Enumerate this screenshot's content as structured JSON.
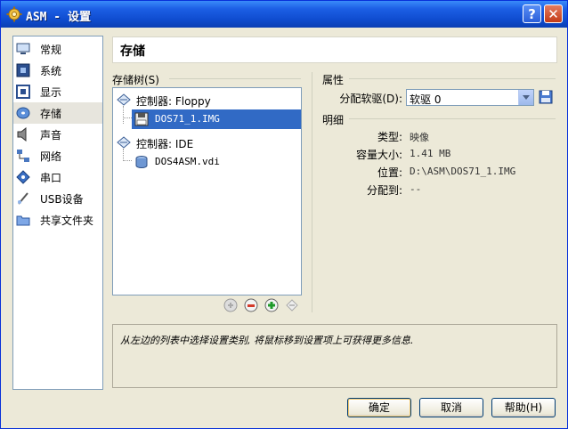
{
  "window": {
    "title": "ASM - 设置"
  },
  "sidebar": {
    "items": [
      {
        "label": "常规",
        "icon": "monitor-icon"
      },
      {
        "label": "系统",
        "icon": "chip-icon"
      },
      {
        "label": "显示",
        "icon": "display-icon"
      },
      {
        "label": "存储",
        "icon": "disk-icon",
        "selected": true
      },
      {
        "label": "声音",
        "icon": "speaker-icon"
      },
      {
        "label": "网络",
        "icon": "network-icon"
      },
      {
        "label": "串口",
        "icon": "serial-port-icon"
      },
      {
        "label": "USB设备",
        "icon": "usb-icon"
      },
      {
        "label": "共享文件夹",
        "icon": "folder-icon"
      }
    ]
  },
  "page": {
    "title": "存储"
  },
  "storage_tree": {
    "label": "存储树(S)",
    "controllers": [
      {
        "label": "控制器: Floppy",
        "attachments": [
          {
            "label": "DOS71_1.IMG",
            "selected": true
          }
        ]
      },
      {
        "label": "控制器: IDE",
        "attachments": [
          {
            "label": "DOS4ASM.vdi"
          }
        ]
      }
    ]
  },
  "attributes": {
    "label": "属性",
    "floppy_drive_label": "分配软驱(D):",
    "floppy_drive_value": "软驱 0"
  },
  "details": {
    "label": "明细",
    "rows": [
      {
        "key": "类型:",
        "value": "映像"
      },
      {
        "key": "容量大小:",
        "value": "1.41 MB"
      },
      {
        "key": "位置:",
        "value": "D:\\ASM\\DOS71_1.IMG"
      },
      {
        "key": "分配到:",
        "value": "--"
      }
    ]
  },
  "info": {
    "text": "从左边的列表中选择设置类别, 将鼠标移到设置项上可获得更多信息."
  },
  "buttons": {
    "ok": "确定",
    "cancel": "取消",
    "help": "帮助(H)"
  },
  "colors": {
    "selection": "#316ac5",
    "titlebar": "#0f4ccf"
  }
}
